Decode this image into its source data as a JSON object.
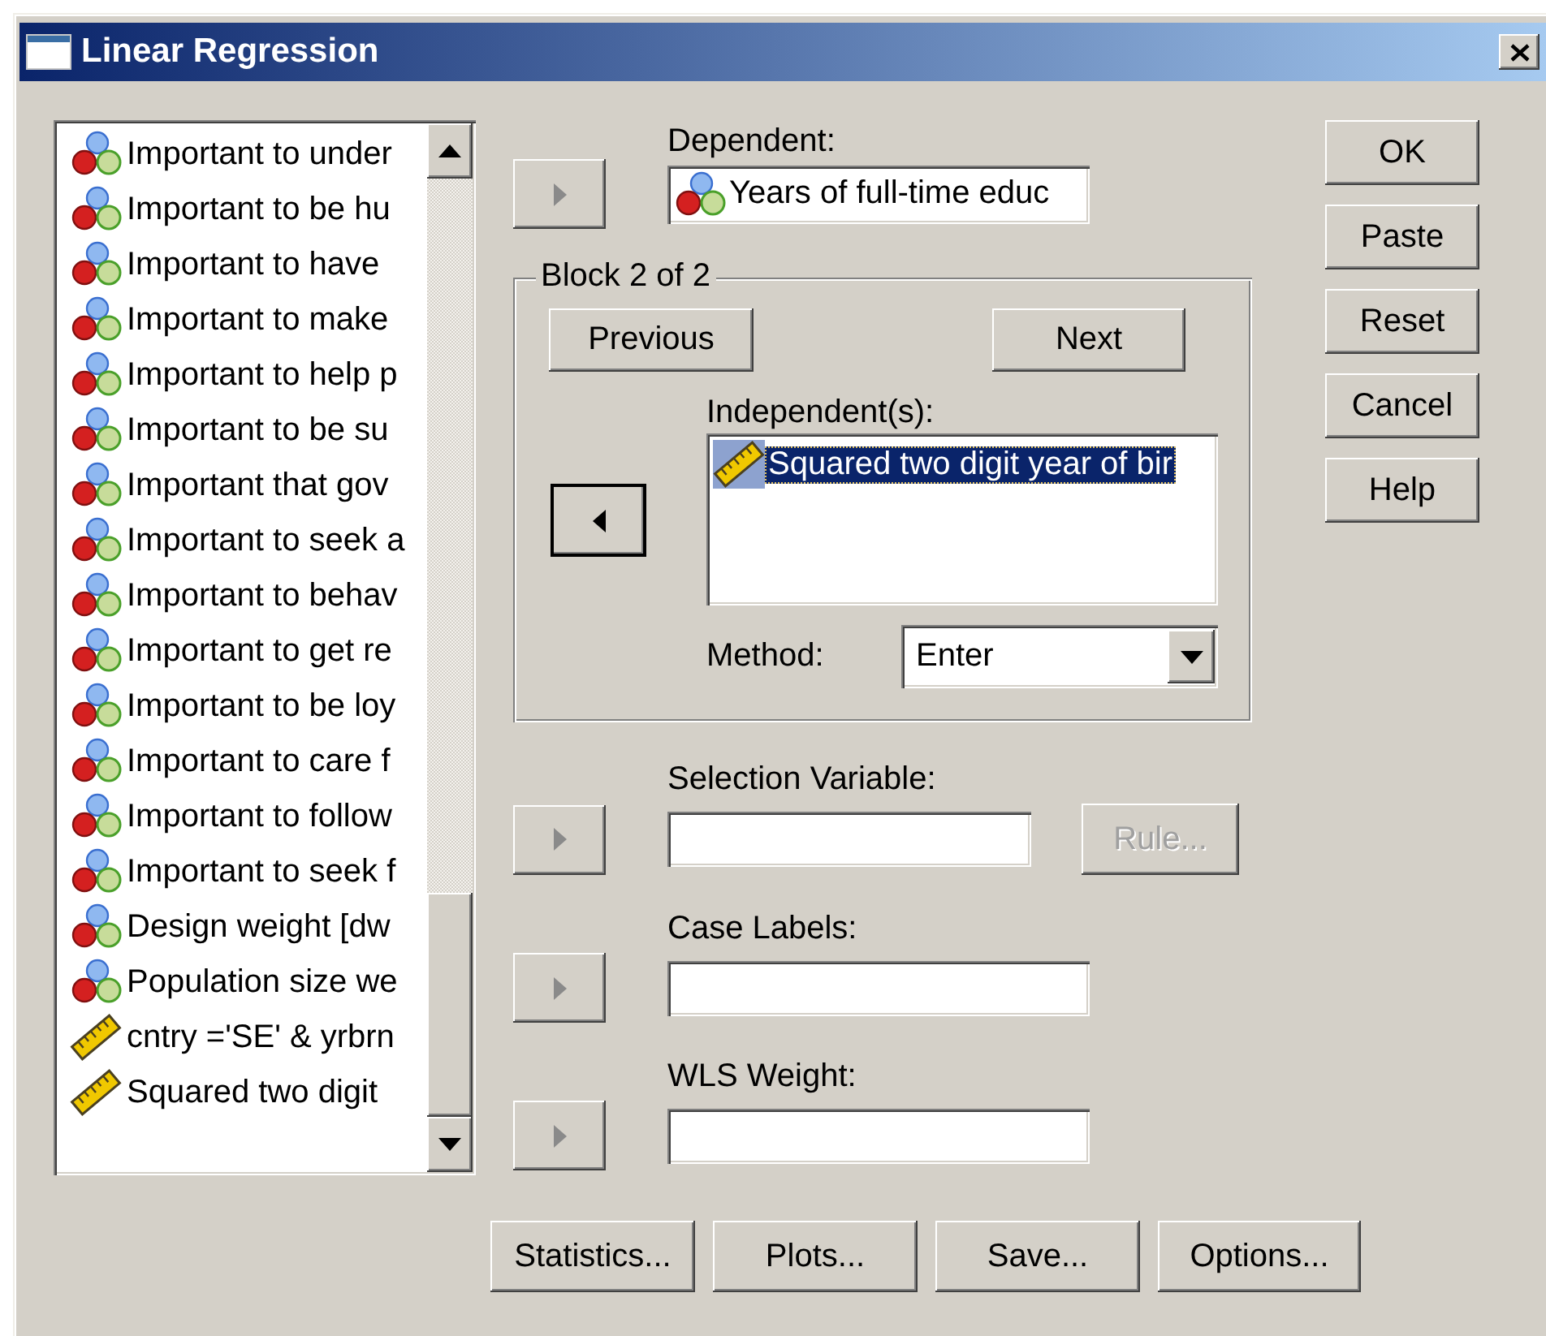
{
  "window": {
    "title": "Linear Regression"
  },
  "variables": [
    {
      "label": "Important to under",
      "kind": "nominal",
      "selected": false
    },
    {
      "label": "Important to be hu",
      "kind": "nominal",
      "selected": false
    },
    {
      "label": "Important to have",
      "kind": "nominal",
      "selected": false
    },
    {
      "label": "Important to make",
      "kind": "nominal",
      "selected": false
    },
    {
      "label": "Important to help p",
      "kind": "nominal",
      "selected": false
    },
    {
      "label": "Important to be su",
      "kind": "nominal",
      "selected": false
    },
    {
      "label": "Important that gov",
      "kind": "nominal",
      "selected": false
    },
    {
      "label": "Important to seek a",
      "kind": "nominal",
      "selected": false
    },
    {
      "label": "Important to behav",
      "kind": "nominal",
      "selected": false
    },
    {
      "label": "Important to get re",
      "kind": "nominal",
      "selected": false
    },
    {
      "label": "Important to be loy",
      "kind": "nominal",
      "selected": false
    },
    {
      "label": "Important to care f",
      "kind": "nominal",
      "selected": false
    },
    {
      "label": "Important to follow",
      "kind": "nominal",
      "selected": false
    },
    {
      "label": "Important to seek f",
      "kind": "nominal",
      "selected": false
    },
    {
      "label": "Design weight [dw",
      "kind": "nominal",
      "selected": false
    },
    {
      "label": "Population size we",
      "kind": "nominal",
      "selected": false
    },
    {
      "label": "cntry ='SE' & yrbrn",
      "kind": "scale",
      "selected": false
    },
    {
      "label": "Squared two digit",
      "kind": "scale",
      "selected": false
    }
  ],
  "dependent": {
    "label": "Dependent:",
    "move_button": {
      "kind": "right",
      "disabled": true,
      "default": false
    },
    "value": {
      "label": "Years of full-time educ",
      "kind": "nominal"
    }
  },
  "block": {
    "title": "Block 2 of 2",
    "previous": {
      "label": "Previous"
    },
    "next": {
      "label": "Next"
    },
    "independents": {
      "label": "Independent(s):",
      "move_button": {
        "kind": "left",
        "disabled": false,
        "default": true
      },
      "items": [
        {
          "label": "Squared two digit year of bir",
          "kind": "scale",
          "selected": true
        }
      ]
    },
    "method": {
      "label": "Method:",
      "value": "Enter"
    }
  },
  "selection": {
    "label": "Selection Variable:",
    "move_button": {
      "kind": "right",
      "disabled": true,
      "default": false
    },
    "rule_button": {
      "label": "Rule...",
      "disabled": true
    }
  },
  "case_labels": {
    "label": "Case Labels:",
    "move_button": {
      "kind": "right",
      "disabled": true,
      "default": false
    }
  },
  "wls_weight": {
    "label": "WLS Weight:",
    "move_button": {
      "kind": "right",
      "disabled": true,
      "default": false
    }
  },
  "bottom_buttons": [
    {
      "label": "Statistics..."
    },
    {
      "label": "Plots..."
    },
    {
      "label": "Save..."
    },
    {
      "label": "Options..."
    }
  ],
  "side_buttons": [
    {
      "label": "OK"
    },
    {
      "label": "Paste"
    },
    {
      "label": "Reset"
    },
    {
      "label": "Cancel"
    },
    {
      "label": "Help"
    }
  ]
}
